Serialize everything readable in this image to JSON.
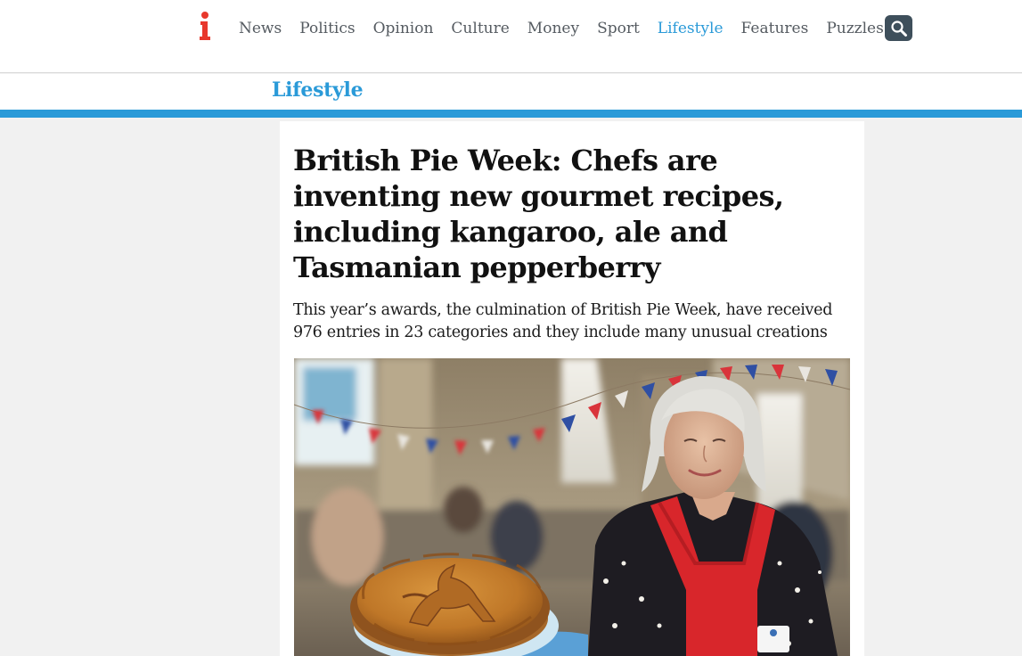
{
  "header": {
    "logo_letter": "i",
    "nav": [
      {
        "label": "News"
      },
      {
        "label": "Politics"
      },
      {
        "label": "Opinion"
      },
      {
        "label": "Culture"
      },
      {
        "label": "Money"
      },
      {
        "label": "Sport"
      },
      {
        "label": "Lifestyle",
        "active": true
      },
      {
        "label": "Features"
      },
      {
        "label": "Puzzles"
      }
    ],
    "search_icon": "search-icon"
  },
  "section": {
    "title": "Lifestyle"
  },
  "article": {
    "headline": "British Pie Week: Chefs are inventing new gourmet recipes, including kangaroo, ale and Tasmanian pepperberry",
    "standfirst": "This year’s awards, the culmination of British Pie Week, have received 976 entries in 23 categories and they include many unusual creations",
    "hero_image": "pie-photo"
  },
  "colors": {
    "accent": "#2a9ad8",
    "logo_red": "#e8382c",
    "search_bg": "#3e4f5b",
    "nav_text": "#555b61"
  }
}
